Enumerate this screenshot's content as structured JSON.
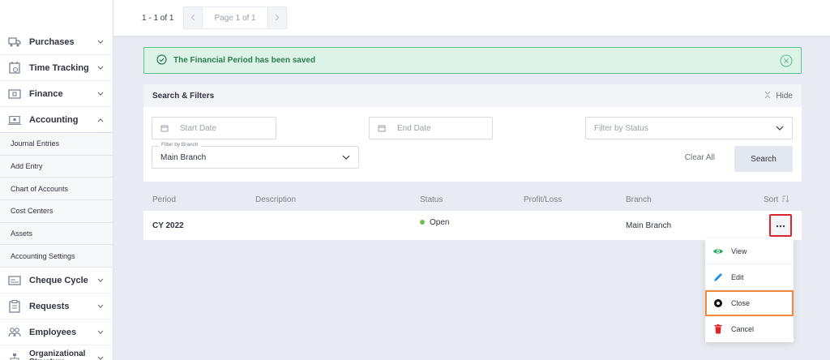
{
  "sidebar": {
    "items_top": [
      {
        "label": "Purchases",
        "icon": "truck-icon"
      },
      {
        "label": "Time Tracking",
        "icon": "calendar-clock-icon"
      },
      {
        "label": "Finance",
        "icon": "cash-icon"
      },
      {
        "label": "Accounting",
        "icon": "cash-register-icon",
        "expanded": true
      }
    ],
    "sub_items": [
      {
        "label": "Journal Entries"
      },
      {
        "label": "Add Entry"
      },
      {
        "label": "Chart of Accounts"
      },
      {
        "label": "Cost Centers"
      },
      {
        "label": "Assets"
      },
      {
        "label": "Accounting Settings"
      }
    ],
    "items_bottom": [
      {
        "label": "Cheque Cycle",
        "icon": "cheque-icon"
      },
      {
        "label": "Requests",
        "icon": "clipboard-icon"
      },
      {
        "label": "Employees",
        "icon": "people-icon"
      },
      {
        "label": "Organizational Structure",
        "icon": "org-chart-icon"
      }
    ]
  },
  "pager": {
    "count": "1 - 1 of 1",
    "page_label": "Page 1 of 1",
    "prev_icon": "chevron-left-icon",
    "next_icon": "chevron-right-icon"
  },
  "alert": {
    "message": "The Financial Period has been saved",
    "color": "#2b7d52"
  },
  "filters": {
    "title": "Search & Filters",
    "hide_label": "Hide",
    "start_date_placeholder": "Start Date",
    "end_date_placeholder": "End Date",
    "status_placeholder": "Filter by Status",
    "branch_legend": "Filter by Branch",
    "branch_value": "Main Branch",
    "clear_all": "Clear All",
    "search": "Search"
  },
  "table": {
    "headers": {
      "period": "Period",
      "description": "Description",
      "status": "Status",
      "profit_loss": "Profit/Loss",
      "branch": "Branch",
      "sort": "Sort"
    },
    "rows": [
      {
        "period": "CY 2022",
        "description": "",
        "status": "Open",
        "status_color": "#6bbf4e",
        "profit_loss": "",
        "branch": "Main Branch"
      }
    ]
  },
  "menu": {
    "items": [
      {
        "label": "View",
        "icon": "eye-icon",
        "color": "#1faa59"
      },
      {
        "label": "Edit",
        "icon": "pencil-icon",
        "color": "#1f8fe0"
      },
      {
        "label": "Close",
        "icon": "circle-dot-icon",
        "color": "#111111",
        "focused": true
      },
      {
        "label": "Cancel",
        "icon": "trash-icon",
        "color": "#e02424"
      }
    ]
  }
}
